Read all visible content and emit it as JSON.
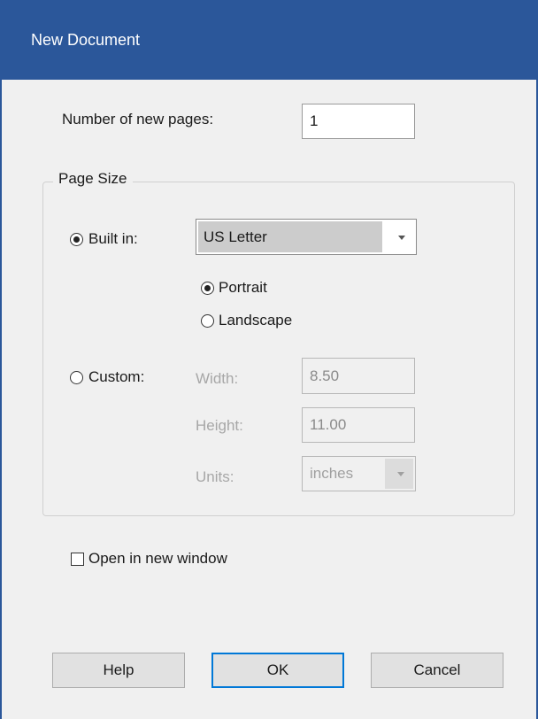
{
  "window": {
    "title": "New Document"
  },
  "pages": {
    "label": "Number of new pages:",
    "value": "1"
  },
  "page_size": {
    "group_label": "Page Size",
    "builtin": {
      "label": "Built in:",
      "selected": true,
      "select_value": "US Letter"
    },
    "orientation": {
      "portrait": {
        "label": "Portrait",
        "selected": true
      },
      "landscape": {
        "label": "Landscape",
        "selected": false
      }
    },
    "custom": {
      "label": "Custom:",
      "selected": false,
      "width_label": "Width:",
      "width_value": "8.50",
      "height_label": "Height:",
      "height_value": "11.00",
      "units_label": "Units:",
      "units_value": "inches"
    }
  },
  "open_new_window": {
    "label": "Open in new window",
    "checked": false
  },
  "buttons": {
    "help": "Help",
    "ok": "OK",
    "cancel": "Cancel"
  },
  "colors": {
    "titlebar": "#2b579a",
    "dialog_bg": "#f0f0f0",
    "default_button_border": "#0078d7"
  }
}
